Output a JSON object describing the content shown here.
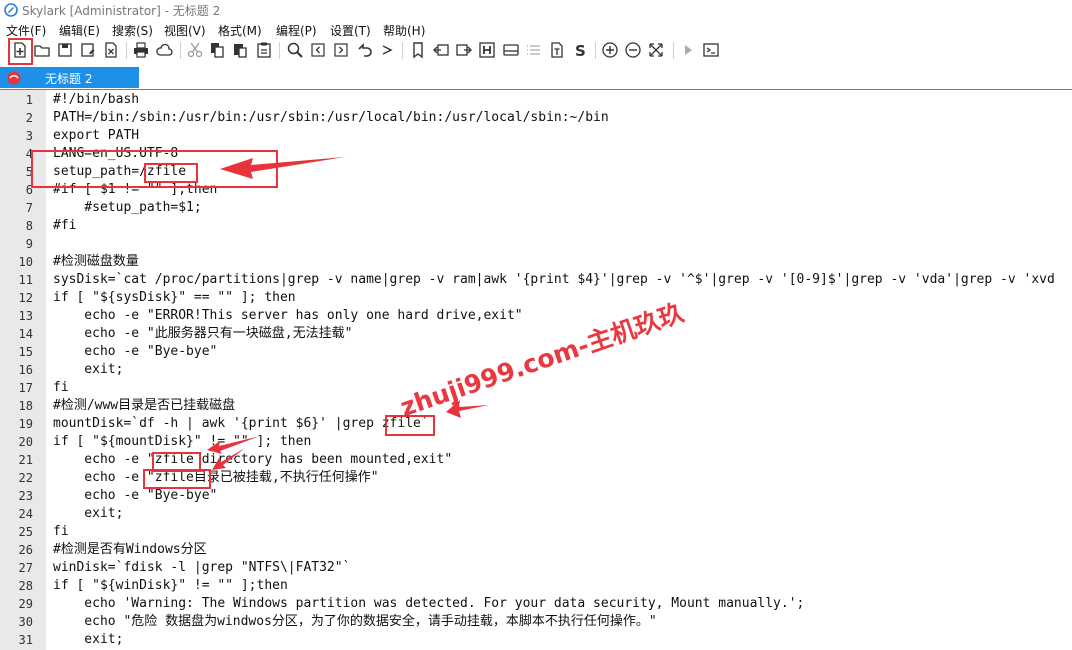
{
  "window": {
    "title": "Skylark [Administrator] - 无标题 2"
  },
  "menu": [
    "文件(F)",
    "编辑(E)",
    "搜索(S)",
    "视图(V)",
    "格式(M)",
    "编程(P)",
    "设置(T)",
    "帮助(H)"
  ],
  "toolbar": {
    "icons": [
      "new-file-icon",
      "open-folder-icon",
      "save-icon",
      "save-as-icon",
      "close-file-icon",
      "print-icon",
      "cloud-icon",
      "cut-icon",
      "copy-icon",
      "paste-icon",
      "clipboard-icon",
      "find-icon",
      "find-previous-icon",
      "find-next-icon",
      "undo-icon",
      "bookmark-icon",
      "goto-icon",
      "indent-icon",
      "header-icon",
      "print-preview-icon",
      "list-icon",
      "file-text-icon",
      "symbol-s-icon",
      "zoom-in-icon",
      "zoom-out-icon",
      "fullscreen-icon",
      "run-icon",
      "terminal-icon"
    ]
  },
  "tab": {
    "label": "无标题 2"
  },
  "editor": {
    "lines": [
      {
        "n": "1",
        "text": "#!/bin/bash"
      },
      {
        "n": "2",
        "text": "PATH=/bin:/sbin:/usr/bin:/usr/sbin:/usr/local/bin:/usr/local/sbin:~/bin"
      },
      {
        "n": "3",
        "text": "export PATH"
      },
      {
        "n": "4",
        "text": "LANG=en_US.UTF-8"
      },
      {
        "n": "5",
        "text": "setup_path=/zfile"
      },
      {
        "n": "6",
        "text": "#if [ $1 != \"\" ];then"
      },
      {
        "n": "7",
        "text": "    #setup_path=$1;"
      },
      {
        "n": "8",
        "text": "#fi"
      },
      {
        "n": "9",
        "text": ""
      },
      {
        "n": "10",
        "text": "#检测磁盘数量"
      },
      {
        "n": "11",
        "text": "sysDisk=`cat /proc/partitions|grep -v name|grep -v ram|awk '{print $4}'|grep -v '^$'|grep -v '[0-9]$'|grep -v 'vda'|grep -v 'xvd"
      },
      {
        "n": "12",
        "text": "if [ \"${sysDisk}\" == \"\" ]; then"
      },
      {
        "n": "13",
        "text": "    echo -e \"ERROR!This server has only one hard drive,exit\""
      },
      {
        "n": "14",
        "text": "    echo -e \"此服务器只有一块磁盘,无法挂载\""
      },
      {
        "n": "15",
        "text": "    echo -e \"Bye-bye\""
      },
      {
        "n": "16",
        "text": "    exit;"
      },
      {
        "n": "17",
        "text": "fi"
      },
      {
        "n": "18",
        "text": "#检测/www目录是否已挂载磁盘"
      },
      {
        "n": "19",
        "text": "mountDisk=`df -h | awk '{print $6}' |grep zfile`"
      },
      {
        "n": "20",
        "text": "if [ \"${mountDisk}\" != \"\" ]; then"
      },
      {
        "n": "21",
        "text": "    echo -e \"zfile directory has been mounted,exit\""
      },
      {
        "n": "22",
        "text": "    echo -e \"zfile目录已被挂载,不执行任何操作\""
      },
      {
        "n": "23",
        "text": "    echo -e \"Bye-bye\""
      },
      {
        "n": "24",
        "text": "    exit;"
      },
      {
        "n": "25",
        "text": "fi"
      },
      {
        "n": "26",
        "text": "#检测是否有Windows分区"
      },
      {
        "n": "27",
        "text": "winDisk=`fdisk -l |grep \"NTFS\\|FAT32\"`"
      },
      {
        "n": "28",
        "text": "if [ \"${winDisk}\" != \"\" ];then"
      },
      {
        "n": "29",
        "text": "    echo 'Warning: The Windows partition was detected. For your data security, Mount manually.';"
      },
      {
        "n": "30",
        "text": "    echo \"危险 数据盘为windwos分区，为了你的数据安全，请手动挂载，本脚本不执行任何操作。\""
      },
      {
        "n": "31",
        "text": "    exit;"
      }
    ]
  },
  "watermark": "zhuji999.com-主机玖玖",
  "colors": {
    "tab_active": "#1e90e8",
    "highlight": "#e8323c",
    "gutter": "#e9e9e9"
  }
}
